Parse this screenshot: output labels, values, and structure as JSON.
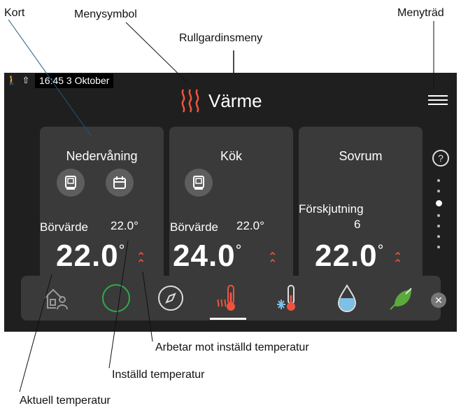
{
  "callouts": {
    "kort": "Kort",
    "menysymbol": "Menysymbol",
    "menytrad": "Menyträd",
    "rullgardinsmeny": "Rullgardinsmeny",
    "arbetar": "Arbetar mot inställd temperatur",
    "installd": "Inställd temperatur",
    "aktuell": "Aktuell temperatur"
  },
  "status": {
    "time": "16:45 3 Oktober",
    "icons": [
      "person-walking-icon",
      "upload-icon"
    ]
  },
  "header": {
    "title": "Värme",
    "icon": "heat-waves-icon",
    "menu_icon": "menu-tree-icon"
  },
  "cards": [
    {
      "name": "Nedervåning",
      "setpoint_label": "Börvärde",
      "setpoint_value": "22.0°",
      "current": "22.0",
      "unit": "°",
      "indicator": "up-chevrons"
    },
    {
      "name": "Kök",
      "setpoint_label": "Börvärde",
      "setpoint_value": "22.0°",
      "current": "24.0",
      "unit": "°",
      "indicator": "up-chevrons"
    },
    {
      "name": "Sovrum",
      "offset_label": "Förskjutning",
      "offset_value": "6",
      "current": "22.0",
      "unit": "°",
      "indicator": "up-chevrons"
    }
  ],
  "help_glyph": "?",
  "pager": {
    "pages": 7,
    "active": 2
  },
  "bottom_tabs": [
    "house-person-icon",
    "circle-icon",
    "compass-icon",
    "heating-thermometer-icon",
    "cooling-thermometer-icon",
    "water-drop-icon",
    "plug-leaf-icon"
  ],
  "active_tab": 3,
  "close_glyph": "✕",
  "colors": {
    "accent": "#f0523e",
    "active_green": "#33a84c",
    "screen_bg": "#1f1f1f",
    "card_bg": "#3a3a3a",
    "water_blue": "#7cc0e8",
    "leaf_green": "#5aab3a"
  }
}
